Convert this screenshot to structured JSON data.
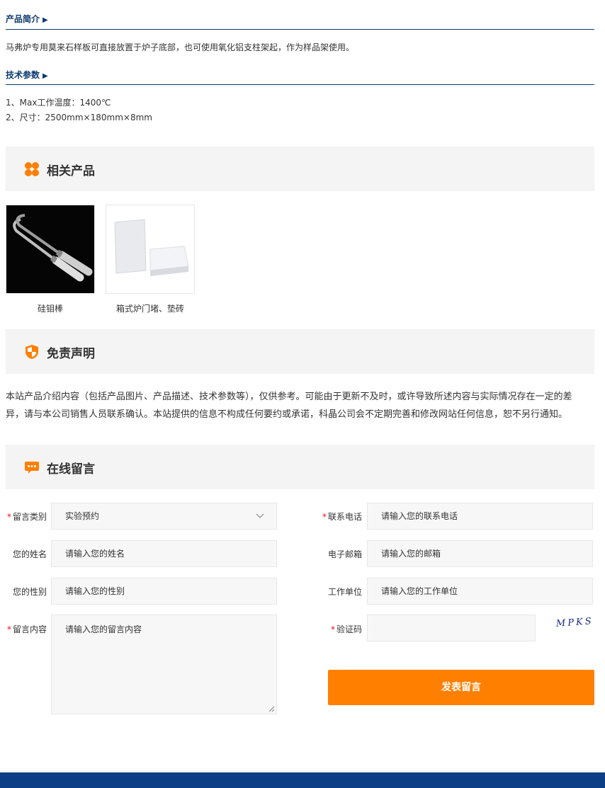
{
  "intro": {
    "title": "产品简介",
    "arrow": "▶",
    "text": "马弗炉专用莫来石样板可直接放置于炉子底部，也可使用氧化铝支柱架起，作为样品架使用。"
  },
  "specs": {
    "title": "技术参数",
    "arrow": "▶",
    "lines": [
      "1、Max工作温度：1400℃",
      "2、尺寸：2500mm×180mm×8mm"
    ]
  },
  "related": {
    "title": "相关产品",
    "items": [
      {
        "name": "硅钼棒",
        "icon": "silicon-molybdenum-rod-image"
      },
      {
        "name": "箱式炉门堵、垫砖",
        "icon": "furnace-door-brick-image"
      }
    ]
  },
  "disclaimer": {
    "title": "免责声明",
    "text": "本站产品介绍内容（包括产品图片、产品描述、技术参数等），仅供参考。可能由于更新不及时，或许导致所述内容与实际情况存在一定的差异，请与本公司销售人员联系确认。本站提供的信息不构成任何要约或承诺，科晶公司会不定期完善和修改网站任何信息，恕不另行通知。"
  },
  "message": {
    "title": "在线留言",
    "required_mark": "*",
    "fields": {
      "category": {
        "label": "留言类别",
        "value": "实验预约"
      },
      "phone": {
        "label": "联系电话",
        "placeholder": "请输入您的联系电话"
      },
      "name": {
        "label": "您的姓名",
        "placeholder": "请输入您的姓名"
      },
      "email": {
        "label": "电子邮箱",
        "placeholder": "请输入您的邮箱"
      },
      "gender": {
        "label": "您的性别",
        "placeholder": "请输入您的性别"
      },
      "company": {
        "label": "工作单位",
        "placeholder": "请输入您的工作单位"
      },
      "content": {
        "label": "留言内容",
        "placeholder": "请输入您的留言内容"
      },
      "captcha": {
        "label": "验证码",
        "value": "",
        "image_text": "MPKS"
      }
    },
    "submit_label": "发表留言"
  },
  "colors": {
    "accent": "#ff7f00",
    "heading_blue": "#0d3a6e",
    "footer": "#0d3f87",
    "required": "#e4101c"
  }
}
